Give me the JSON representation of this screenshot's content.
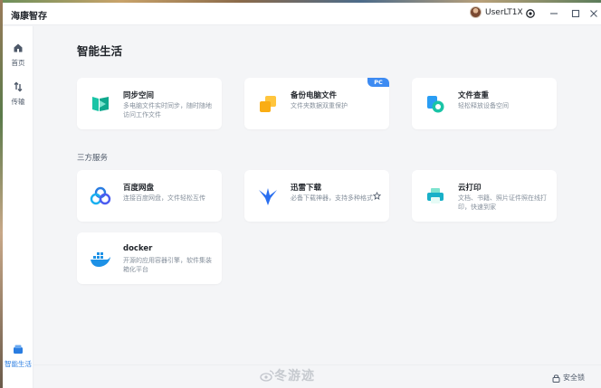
{
  "app": {
    "title": "海康智存"
  },
  "user": {
    "name": "UserLT1X"
  },
  "sidebar": {
    "items": [
      {
        "label": "首页",
        "icon": "home-icon"
      },
      {
        "label": "传输",
        "icon": "transfer-icon"
      },
      {
        "label": "智能生活",
        "icon": "smart-life-icon",
        "active": true
      }
    ]
  },
  "main": {
    "title": "智能生活",
    "cards": [
      {
        "title": "同步空间",
        "desc": "多电脑文件实时同步，随时随地访问工作文件",
        "icon": "sync-space-icon"
      },
      {
        "title": "备份电脑文件",
        "desc": "文件夹数据双重保护",
        "badge": "PC",
        "icon": "backup-icon"
      },
      {
        "title": "文件查重",
        "desc": "轻松释放设备空间",
        "icon": "dedupe-icon"
      }
    ],
    "third_party_title": "三方服务",
    "services": [
      {
        "title": "百度网盘",
        "desc": "连接百度网盘，文件轻松互传",
        "icon": "baidu-netdisk-icon"
      },
      {
        "title": "迅雷下载",
        "desc": "必备下载神器，支持多种格式",
        "icon": "thunder-icon"
      },
      {
        "title": "云打印",
        "desc": "文档、书籍、照片证件照在线打印，快速到家",
        "icon": "cloud-print-icon"
      },
      {
        "title": "docker",
        "desc": "开源的应用容器引擎，软件集装箱化平台",
        "icon": "docker-icon"
      }
    ]
  },
  "status": {
    "lock_label": "安全锁",
    "watermark": "冬游迹"
  },
  "colors": {
    "accent": "#2a7de1",
    "badge": "#3d8bf2",
    "background": "#f4f5f7"
  }
}
